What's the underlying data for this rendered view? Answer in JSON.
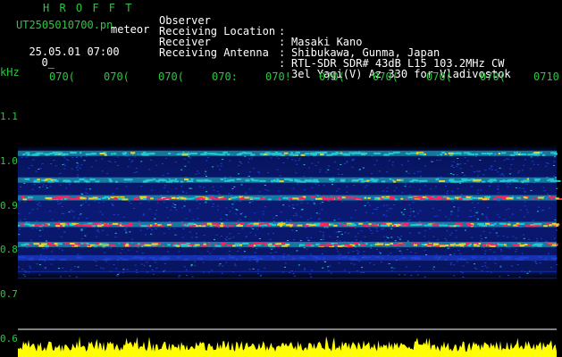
{
  "header": {
    "brand": "H R O F F T",
    "filename": "UT2505010700.pn",
    "tag": "meteor",
    "datetime": "25.05.01 07:00",
    "datetime_extra": "0_"
  },
  "meta": [
    {
      "label": "Observer",
      "sep": ":",
      "value": "Masaki Kano"
    },
    {
      "label": "Receiving Location",
      "sep": ":",
      "value": "Shibukawa, Gunma, Japan"
    },
    {
      "label": "Receiver",
      "sep": ":",
      "value": "RTL-SDR SDR# 43dB L15 103.2MHz CW"
    },
    {
      "label": "Receiving Antenna",
      "sep": ":",
      "value": "3el Yagi(V) Az 330 for Vladivostok"
    }
  ],
  "axis": {
    "y_unit": "kHz",
    "y_ticks": [
      "1.1",
      "1.0",
      "0.9",
      "0.8",
      "0.7",
      "0.6"
    ],
    "x_ticks": [
      "070(",
      "070(",
      "070(",
      "070:",
      "070!",
      "070(",
      "070(",
      "070(",
      "070(",
      "0710"
    ]
  },
  "spectrogram": {
    "freq_range_khz": [
      0.6,
      1.15
    ],
    "bands_khz": [
      {
        "f": 1.02,
        "level": "medium"
      },
      {
        "f": 0.96,
        "level": "medium"
      },
      {
        "f": 0.92,
        "level": "strong"
      },
      {
        "f": 0.86,
        "level": "strong"
      },
      {
        "f": 0.815,
        "level": "strong"
      },
      {
        "f": 0.785,
        "level": "weak"
      }
    ],
    "colors": {
      "bg": "#0a1a75",
      "low": "#1e3fd0",
      "mid": "#20c8d0",
      "high": "#f0d020",
      "peak": "#ff2060"
    },
    "amplitude_trace_color": "#ffff00"
  }
}
